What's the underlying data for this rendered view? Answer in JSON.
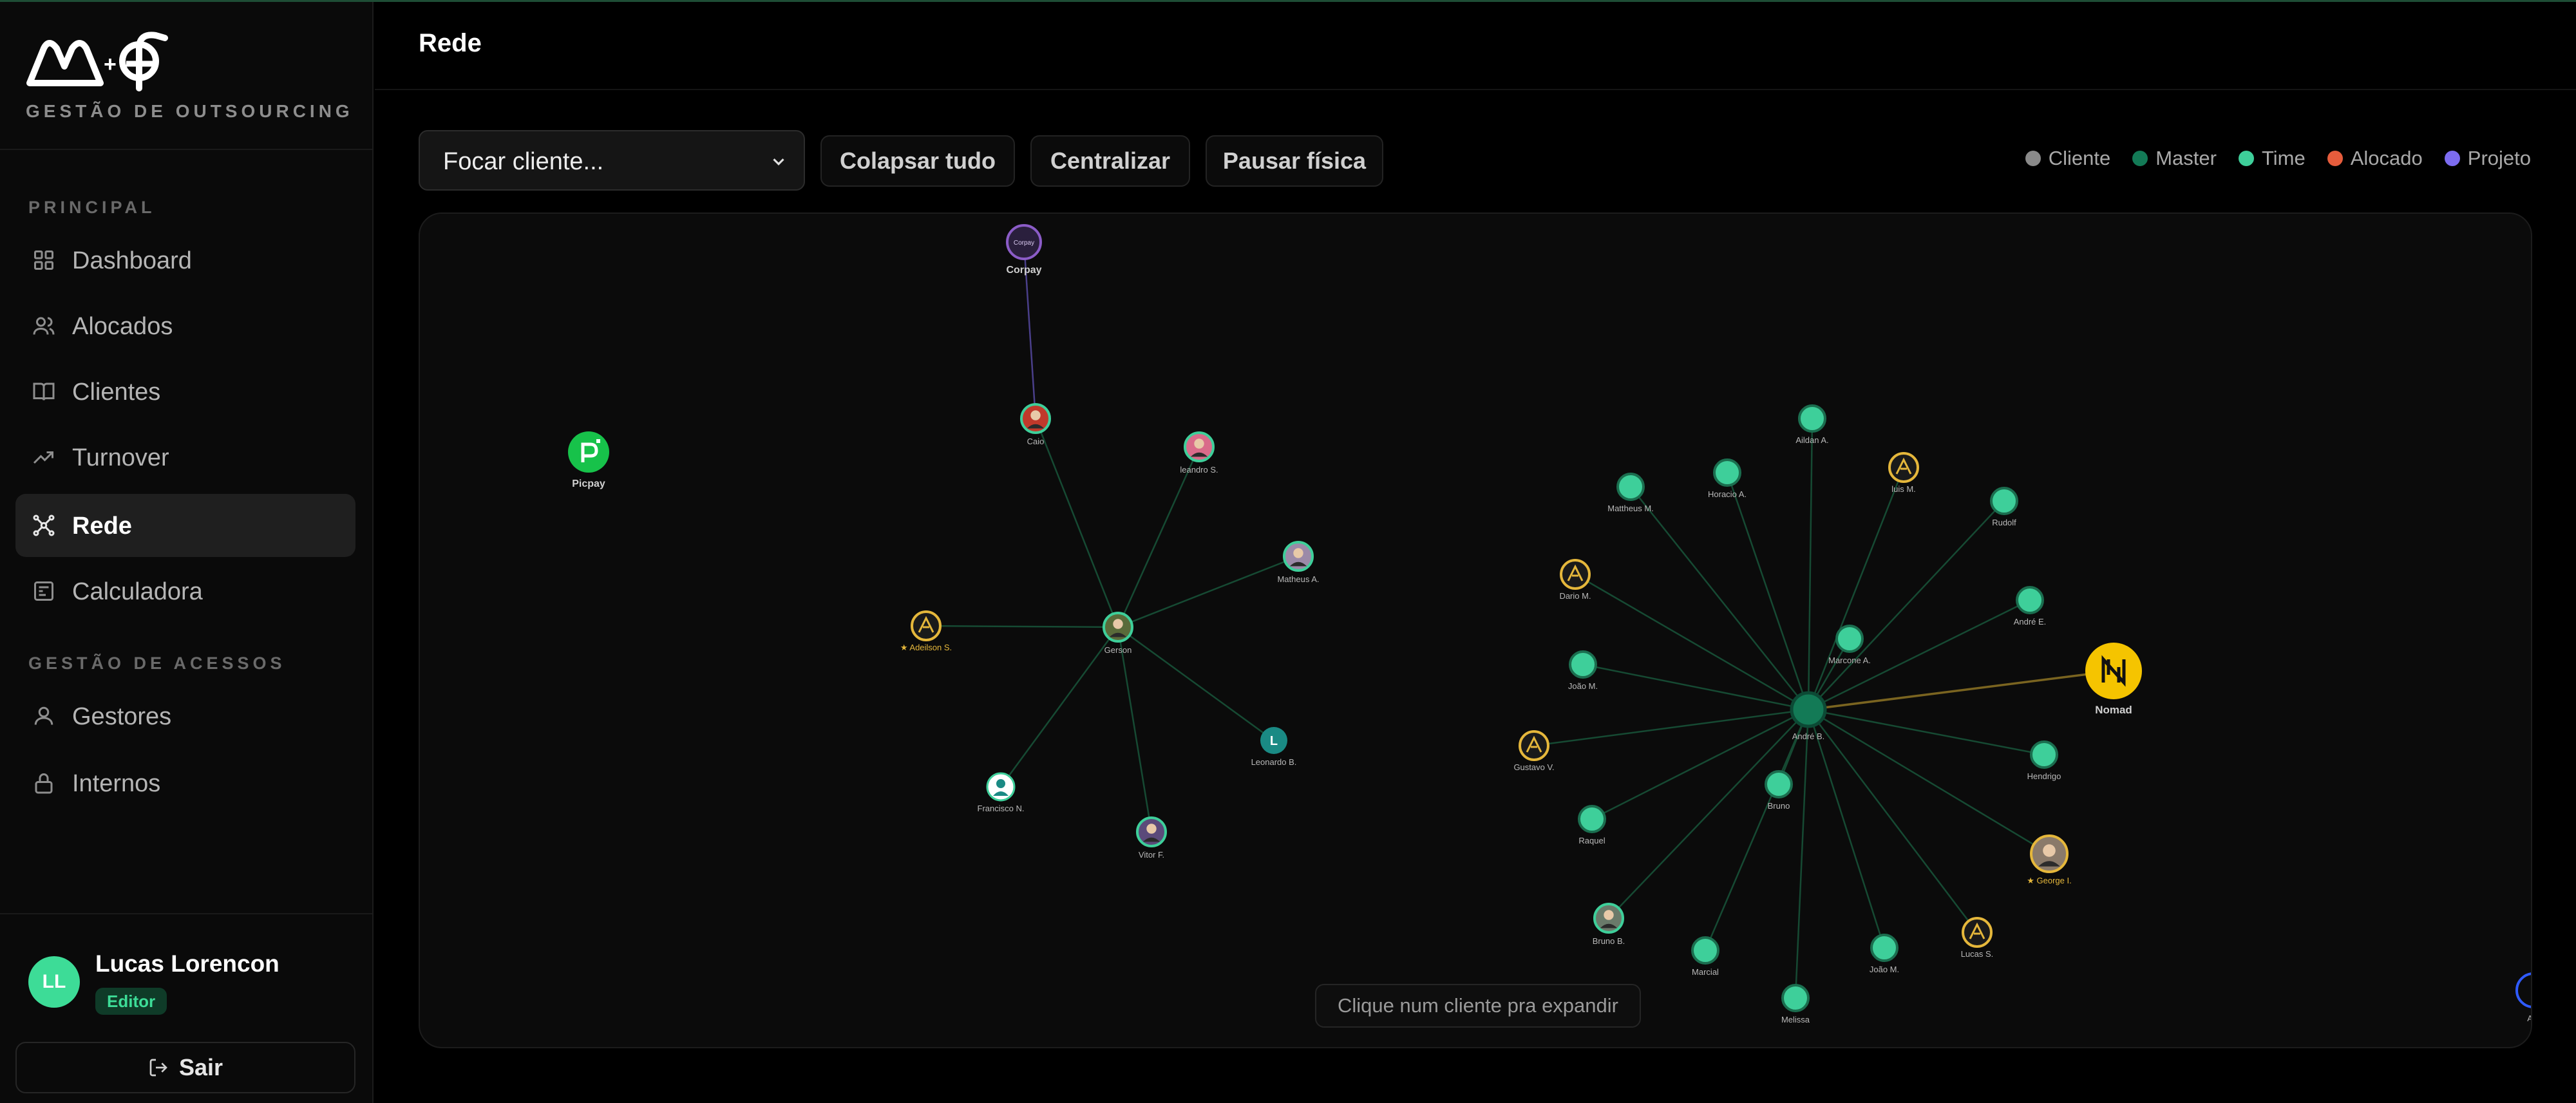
{
  "brand": {
    "tagline": "GESTÃO DE OUTSOURCING"
  },
  "sidebar": {
    "section_principal": "PRINCIPAL",
    "section_access": "GESTÃO DE ACESSOS",
    "items": [
      {
        "label": "Dashboard",
        "icon": "grid-icon"
      },
      {
        "label": "Alocados",
        "icon": "users-icon"
      },
      {
        "label": "Clientes",
        "icon": "book-icon"
      },
      {
        "label": "Turnover",
        "icon": "trending-up-icon"
      },
      {
        "label": "Rede",
        "icon": "network-icon",
        "active": true
      },
      {
        "label": "Calculadora",
        "icon": "calculator-icon"
      },
      {
        "label": "Gestores",
        "icon": "user-icon"
      },
      {
        "label": "Internos",
        "icon": "lock-icon"
      }
    ]
  },
  "user": {
    "initials": "LL",
    "name": "Lucas Lorencon",
    "role": "Editor",
    "logout_label": "Sair"
  },
  "header": {
    "title": "Rede"
  },
  "toolbar": {
    "focus_placeholder": "Focar cliente...",
    "collapse_label": "Colapsar tudo",
    "center_label": "Centralizar",
    "pause_label": "Pausar física"
  },
  "legend": [
    {
      "label": "Cliente",
      "color": "#8a8a8a"
    },
    {
      "label": "Master",
      "color": "#137a56"
    },
    {
      "label": "Time",
      "color": "#3ecf9a"
    },
    {
      "label": "Alocado",
      "color": "#e65c3c"
    },
    {
      "label": "Projeto",
      "color": "#7c6cf0"
    }
  ],
  "graph": {
    "hint": "Clique num cliente pra expandir",
    "nodes": [
      {
        "id": "corpay",
        "label": "Corpay",
        "badge": "Corpay",
        "kind": "client-corpay"
      },
      {
        "id": "picpay",
        "label": "Picpay",
        "kind": "client-picpay"
      },
      {
        "id": "nomad",
        "label": "Nomad",
        "kind": "client-nomad"
      },
      {
        "id": "aut",
        "label": "Aut",
        "kind": "client-edge"
      },
      {
        "id": "caio",
        "label": "Caio",
        "kind": "photo",
        "color": "#c0392b"
      },
      {
        "id": "gerson",
        "label": "Gerson",
        "kind": "photo",
        "color": "#5a6b3a"
      },
      {
        "id": "leandro",
        "label": "leandro S.",
        "kind": "photo",
        "color": "#d96b8a"
      },
      {
        "id": "matheusA",
        "label": "Matheus A.",
        "kind": "photo",
        "color": "#9c8aa8"
      },
      {
        "id": "adeilson",
        "label": "Adeilson S.",
        "kind": "gold",
        "star": true
      },
      {
        "id": "leonardo",
        "label": "Leonardo B.",
        "kind": "letter",
        "letter": "L"
      },
      {
        "id": "francisco",
        "label": "Francisco N.",
        "kind": "avatar-white"
      },
      {
        "id": "vitor",
        "label": "Vitor F.",
        "kind": "photo",
        "color": "#5b4a7a"
      },
      {
        "id": "andre",
        "label": "André B.",
        "kind": "master"
      },
      {
        "id": "aildan",
        "label": "Aildan A.",
        "kind": "time"
      },
      {
        "id": "horacio",
        "label": "Horacio A.",
        "kind": "time"
      },
      {
        "id": "luisM",
        "label": "luis M.",
        "kind": "gold"
      },
      {
        "id": "matheusM",
        "label": "Mattheus M.",
        "kind": "time"
      },
      {
        "id": "rudolf",
        "label": "Rudolf",
        "kind": "time"
      },
      {
        "id": "dario",
        "label": "Dario M.",
        "kind": "gold"
      },
      {
        "id": "andreE",
        "label": "André E.",
        "kind": "time"
      },
      {
        "id": "marcone",
        "label": "Marcone A.",
        "kind": "time"
      },
      {
        "id": "joaoM1",
        "label": "João M.",
        "kind": "time"
      },
      {
        "id": "gustavo",
        "label": "Gustavo V.",
        "kind": "gold"
      },
      {
        "id": "hendrigo",
        "label": "Hendrigo",
        "kind": "time"
      },
      {
        "id": "bruno",
        "label": "Bruno",
        "kind": "time"
      },
      {
        "id": "raquel",
        "label": "Raquel",
        "kind": "time"
      },
      {
        "id": "george",
        "label": "George I.",
        "kind": "photo-gold",
        "star": true,
        "color": "#8a7a6a"
      },
      {
        "id": "brunoB",
        "label": "Bruno B.",
        "kind": "photo",
        "color": "#6a7a6a"
      },
      {
        "id": "lucasS",
        "label": "Lucas S.",
        "kind": "gold"
      },
      {
        "id": "marcial",
        "label": "Marcial",
        "kind": "time"
      },
      {
        "id": "joaoM2",
        "label": "João M.",
        "kind": "time"
      },
      {
        "id": "melissa",
        "label": "Melissa",
        "kind": "time"
      }
    ],
    "edges": [
      [
        "corpay",
        "caio",
        "project"
      ],
      [
        "caio",
        "gerson",
        "team"
      ],
      [
        "leandro",
        "gerson",
        "team"
      ],
      [
        "matheusA",
        "gerson",
        "team"
      ],
      [
        "adeilson",
        "gerson",
        "team"
      ],
      [
        "leonardo",
        "gerson",
        "team"
      ],
      [
        "francisco",
        "gerson",
        "team"
      ],
      [
        "vitor",
        "gerson",
        "team"
      ],
      [
        "andre",
        "nomad",
        "client"
      ],
      [
        "andre",
        "aildan",
        "team"
      ],
      [
        "andre",
        "horacio",
        "team"
      ],
      [
        "andre",
        "luisM",
        "team"
      ],
      [
        "andre",
        "matheusM",
        "team"
      ],
      [
        "andre",
        "rudolf",
        "team"
      ],
      [
        "andre",
        "dario",
        "team"
      ],
      [
        "andre",
        "andreE",
        "team"
      ],
      [
        "andre",
        "marcone",
        "team"
      ],
      [
        "andre",
        "joaoM1",
        "team"
      ],
      [
        "andre",
        "gustavo",
        "team"
      ],
      [
        "andre",
        "hendrigo",
        "team"
      ],
      [
        "andre",
        "bruno",
        "team"
      ],
      [
        "andre",
        "raquel",
        "team"
      ],
      [
        "andre",
        "george",
        "team"
      ],
      [
        "andre",
        "brunoB",
        "team"
      ],
      [
        "andre",
        "lucasS",
        "team"
      ],
      [
        "andre",
        "marcial",
        "team"
      ],
      [
        "andre",
        "joaoM2",
        "team"
      ],
      [
        "andre",
        "melissa",
        "team"
      ]
    ]
  }
}
